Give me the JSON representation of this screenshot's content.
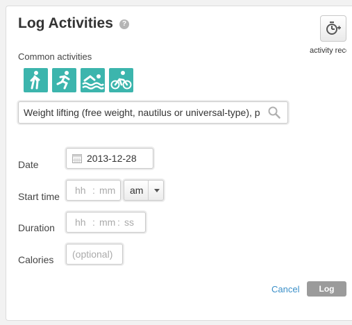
{
  "header": {
    "title": "Log Activities",
    "help_icon": "?",
    "record_icon": "stopwatch-plus-icon",
    "record_label": "activity recorder"
  },
  "common_activities": {
    "label": "Common activities",
    "items": [
      {
        "name": "Walk",
        "icon": "walking-icon"
      },
      {
        "name": "Run",
        "icon": "running-icon"
      },
      {
        "name": "Swim",
        "icon": "swimming-icon"
      },
      {
        "name": "Bike",
        "icon": "cycling-icon"
      }
    ]
  },
  "search": {
    "value": "Weight lifting (free weight, nautilus or universal-type), p",
    "icon": "search-icon"
  },
  "form": {
    "date": {
      "label": "Date",
      "value": "2013-12-28",
      "icon": "calendar-icon"
    },
    "start_time": {
      "label": "Start time",
      "hh": "hh",
      "mm": "mm",
      "sep": ":",
      "ampm": "am"
    },
    "duration": {
      "label": "Duration",
      "hh": "hh",
      "mm": "mm",
      "ss": "ss",
      "sep": ":"
    },
    "calories": {
      "label": "Calories",
      "placeholder": "(optional)"
    }
  },
  "actions": {
    "cancel": "Cancel",
    "log": "Log"
  },
  "colors": {
    "accent": "#3cb5ad",
    "link": "#3a8fc8",
    "button": "#9b9b9b"
  }
}
